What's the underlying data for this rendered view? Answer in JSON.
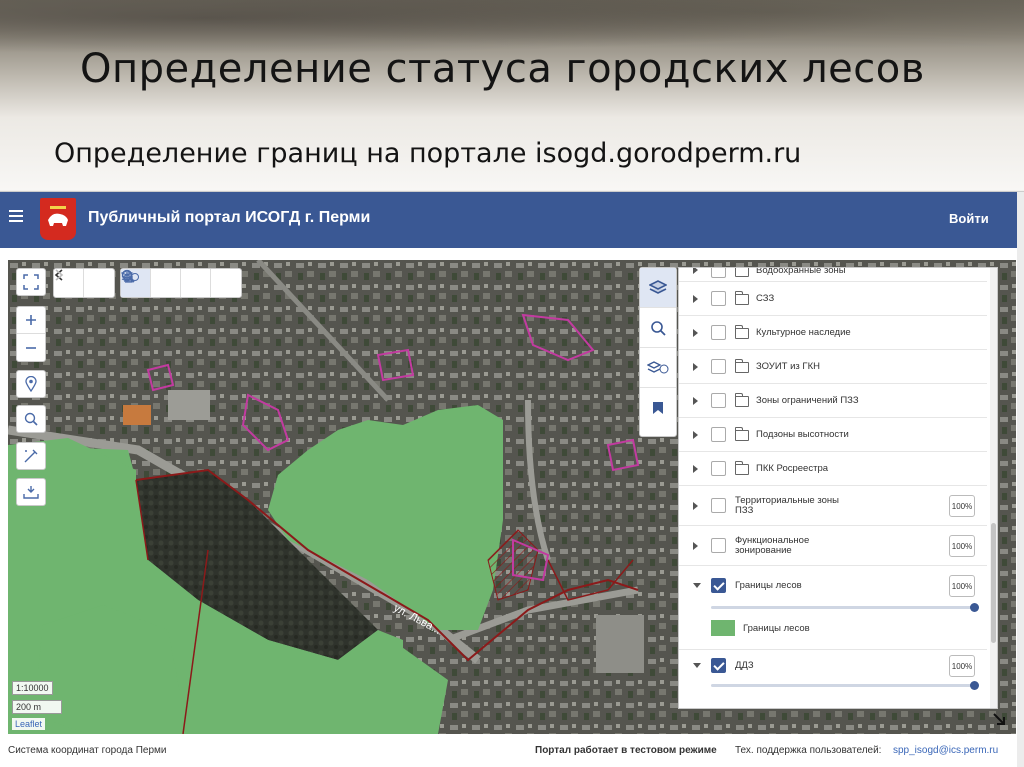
{
  "slide": {
    "title": "Определение статуса городских лесов",
    "subtitle": "Определение границ на портале isogd.gorodperm.ru"
  },
  "header": {
    "title": "Публичный портал ИСОГД г. Перми",
    "login": "Войти"
  },
  "map": {
    "street_label": "ул. Льва...",
    "attribution": "Leaflet",
    "scale_ratio": "1:10000",
    "scale_distance": "200 m",
    "colors": {
      "forest": "#6fb56f",
      "boundary": "#8b1a1a",
      "pink": "#c23ba0"
    }
  },
  "layers": [
    {
      "label": "Водоохранные зоны",
      "folder": true,
      "checked": false
    },
    {
      "label": "СЗЗ",
      "folder": true,
      "checked": false
    },
    {
      "label": "Культурное наследие",
      "folder": true,
      "checked": false
    },
    {
      "label": "ЗОУИТ из ГКН",
      "folder": true,
      "checked": false
    },
    {
      "label": "Зоны ограничений ПЗЗ",
      "folder": true,
      "checked": false
    },
    {
      "label": "Подзоны высотности",
      "folder": true,
      "checked": false
    },
    {
      "label": "ПКК Росреестра",
      "folder": true,
      "checked": false
    },
    {
      "label_line1": "Территориальные зоны",
      "label_line2": "ПЗЗ",
      "folder": false,
      "checked": false,
      "opacity": "100%"
    },
    {
      "label_line1": "Функциональное",
      "label_line2": "зонирование",
      "folder": false,
      "checked": false,
      "opacity": "100%"
    },
    {
      "label": "Границы лесов",
      "folder": false,
      "checked": true,
      "opacity": "100%",
      "slider_level": 1.0,
      "legend": "Границы лесов"
    },
    {
      "label": "ДДЗ",
      "folder": false,
      "checked": true,
      "opacity": "100%",
      "slider_level": 1.0
    }
  ],
  "footer": {
    "coord_system": "Система координат города Перми",
    "test_mode": "Портал работает в тестовом режиме",
    "support_label": "Тех. поддержка пользователей:",
    "support_email": "spp_isogd@ics.perm.ru"
  },
  "icons": [
    "menu-icon",
    "crest-logo",
    "fullscreen-icon",
    "back-arrow-icon",
    "forward-arrow-icon",
    "pan-hand-icon",
    "zoom-in-area-icon",
    "zoom-out-area-icon",
    "layer-info-icon",
    "zoom-in-icon",
    "zoom-out-icon",
    "location-pin-icon",
    "search-icon",
    "measure-icon",
    "download-icon",
    "layers-icon",
    "bookmark-icon",
    "resize-icon"
  ]
}
